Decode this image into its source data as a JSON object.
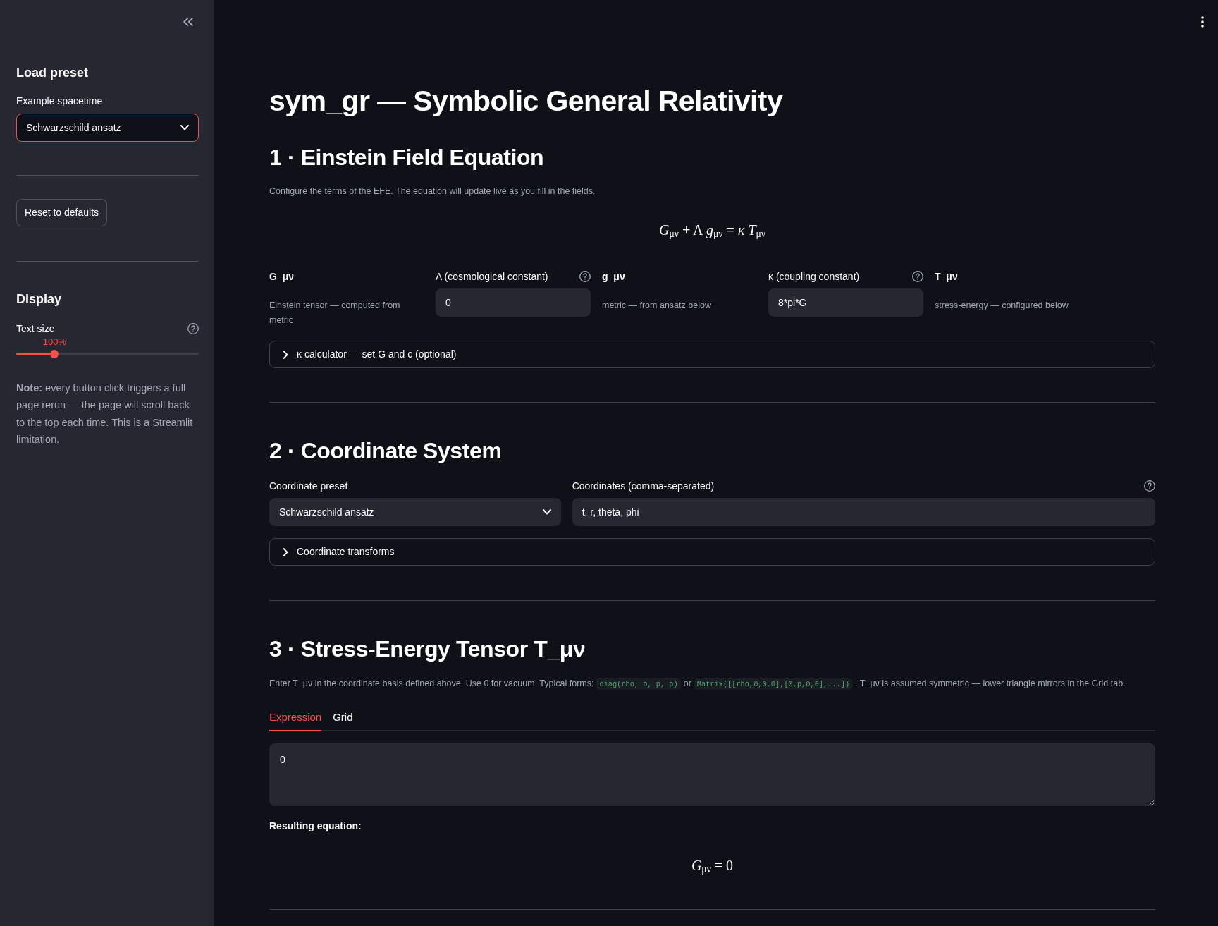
{
  "sidebar": {
    "load_preset": {
      "heading": "Load preset",
      "select": {
        "label": "Example spacetime",
        "value": "Schwarzschild ansatz",
        "focused": true
      }
    },
    "reset_button": "Reset to defaults",
    "display": {
      "heading": "Display",
      "slider": {
        "label": "Text size",
        "reading": "100%",
        "level": 0.21
      }
    },
    "note": "**Note:** every button click triggers a full page rerun — the page will scroll back to the top each time. This is a Streamlit limitation."
  },
  "main": {
    "title": "sym_gr — Symbolic General Relativity",
    "efe_section": {
      "heading": "1 · Einstein Field Equation",
      "caption": "Configure the terms of the EFE. The equation will update live as you fill in the fields.",
      "equation": "*G*$_{μν}$ + Λ *g*$_{μν}$ = *κ T*$_{μν}$",
      "terms": [
        {
          "kind": "info",
          "label": "G_μν",
          "description": "Einstein tensor — computed from metric"
        },
        {
          "kind": "input",
          "label": "Λ (cosmological constant)",
          "value": "0"
        },
        {
          "kind": "info",
          "label": "g_μν",
          "description": "metric — from ansatz below"
        },
        {
          "kind": "input",
          "label": "κ (coupling constant)",
          "value": "8*pi*G"
        },
        {
          "kind": "info",
          "label": "T_μν",
          "description": "stress-energy — configured below"
        }
      ],
      "expander": {
        "label": "κ calculator — set G and c (optional)",
        "expanded": false
      }
    },
    "coordinate_section": {
      "heading": "2 · Coordinate System",
      "fields": [
        {
          "kind": "select",
          "label": "Coordinate preset",
          "value": "Schwarzschild ansatz",
          "focused": false
        },
        {
          "kind": "input",
          "label": "Coordinates (comma-separated)",
          "value": "t, r, theta, phi"
        }
      ],
      "expander": {
        "label": "Coordinate transforms",
        "expanded": false
      }
    },
    "stress_energy_section": {
      "heading": "3 · Stress-Energy Tensor T_μν",
      "description": [
        {
          "kind": "text",
          "text": "Enter T_μν in the coordinate basis defined above. Use 0 for vacuum. Typical forms:"
        },
        {
          "kind": "code",
          "text": "diag(rho, p, p, p)"
        },
        {
          "kind": "text",
          "text": "or"
        },
        {
          "kind": "code",
          "text": "Matrix([[rho,0,0,0],[0,p,0,0],...])"
        },
        {
          "kind": "text",
          "text": ". T_μν is assumed symmetric — lower triangle mirrors in the Grid tab."
        }
      ],
      "tabs": [
        {
          "label": "Expression",
          "selected": true
        },
        {
          "label": "Grid",
          "selected": false
        }
      ],
      "expression": "0",
      "result_label": "Resulting equation:",
      "result_equation": "*G*$_{μν}$ = 0"
    }
  }
}
